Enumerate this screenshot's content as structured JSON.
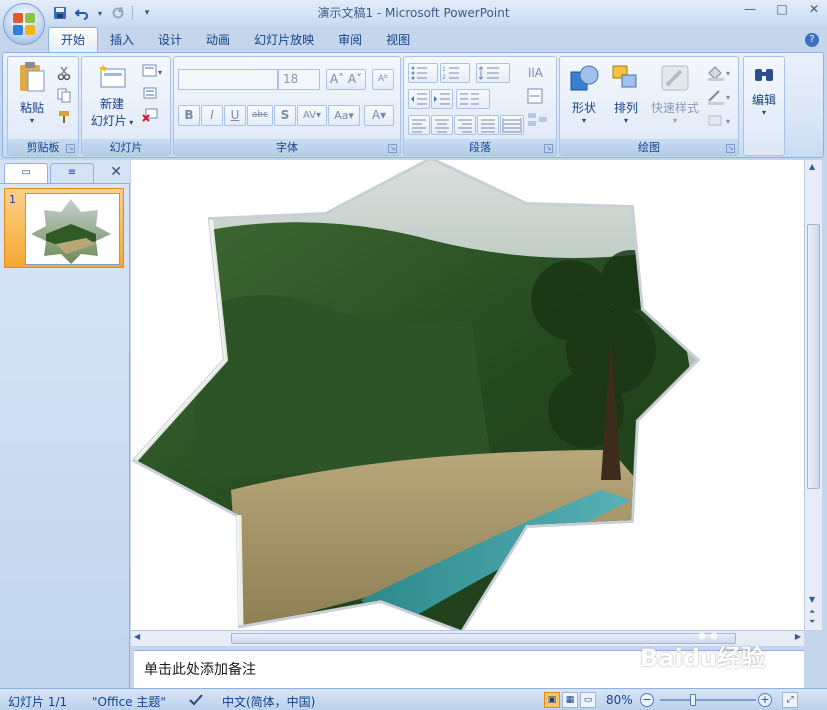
{
  "window": {
    "title": "演示文稿1 - Microsoft PowerPoint",
    "controls": [
      "—",
      "□",
      "✕"
    ]
  },
  "qat": {
    "save_icon": "save-icon",
    "undo_icon": "undo-icon",
    "redo_icon": "redo-icon"
  },
  "tabs": [
    {
      "label": "开始",
      "active": true
    },
    {
      "label": "插入"
    },
    {
      "label": "设计"
    },
    {
      "label": "动画"
    },
    {
      "label": "幻灯片放映"
    },
    {
      "label": "审阅"
    },
    {
      "label": "视图"
    }
  ],
  "ribbon": {
    "clipboard": {
      "label": "剪贴板",
      "paste": "粘贴"
    },
    "slides": {
      "label": "幻灯片",
      "new_slide_line1": "新建",
      "new_slide_line2": "幻灯片"
    },
    "font": {
      "label": "字体",
      "font_name": "",
      "font_size": "18"
    },
    "paragraph": {
      "label": "段落"
    },
    "drawing": {
      "label": "绘图",
      "shapes": "形状",
      "arrange": "排列",
      "quick_styles": "快速样式"
    },
    "editing": {
      "label": "编辑"
    }
  },
  "left_pane": {
    "slide_number": "1",
    "close": "✕"
  },
  "notes": {
    "placeholder": "单击此处添加备注"
  },
  "statusbar": {
    "slide_info": "幻灯片 1/1",
    "theme": "\"Office 主题\"",
    "language": "中文(简体，中国)",
    "zoom": "80%",
    "zoom_level": 0.4
  },
  "watermark": {
    "brand": "Baidu经验",
    "url": "jingyan.baidu.com"
  },
  "colors": {
    "accent": "#15428b",
    "ribbon_bg": "#dbe7f6",
    "active_thumb": "#f6a933"
  }
}
